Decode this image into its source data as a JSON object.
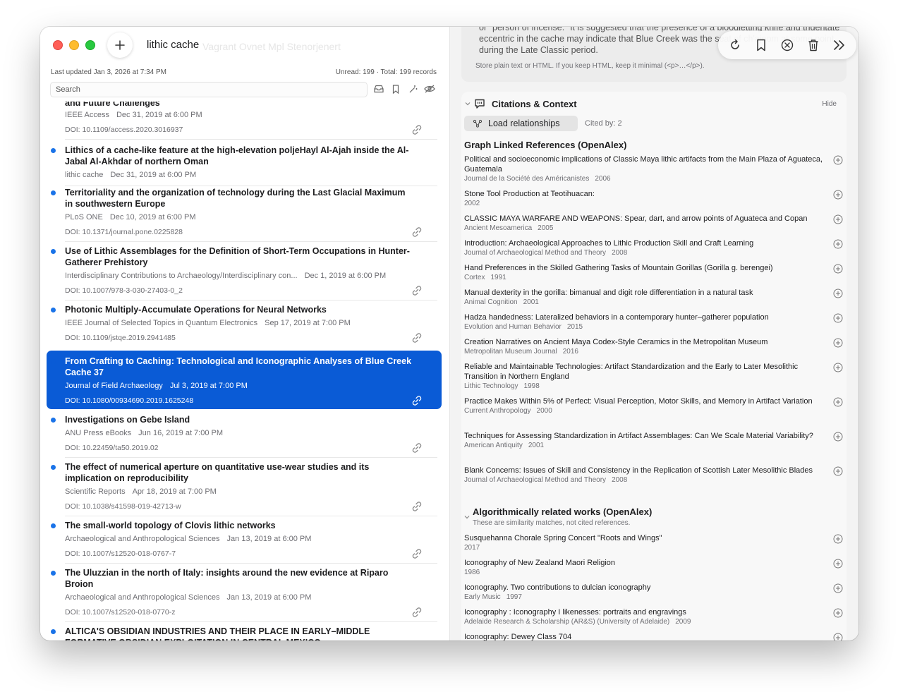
{
  "window": {
    "title": "lithic cache",
    "ghost_title": "Vagrant Ovnet Mpl Stenorjenert",
    "last_updated": "Last updated Jan 3, 2026 at 7:34 PM",
    "counts": "Unread: 199 · Total: 199 records",
    "search_placeholder": "Search"
  },
  "list": {
    "items": [
      {
        "title": "and Future Challenges",
        "source": "IEEE Access",
        "date": "Dec 31, 2019 at 6:00 PM",
        "doi": "DOI: 10.1109/access.2020.3016937",
        "unread": false
      },
      {
        "title": "Lithics of a cache-like feature at the high-elevation poljeHayl Al-Ajah inside the Al-Jabal Al-Akhdar of northern Oman",
        "source": "lithic cache",
        "date": "Dec 31, 2019 at 6:00 PM",
        "doi": "",
        "unread": true
      },
      {
        "title": "Territoriality and the organization of technology during the Last Glacial Maximum in southwestern Europe",
        "source": "PLoS ONE",
        "date": "Dec 10, 2019 at 6:00 PM",
        "doi": "DOI: 10.1371/journal.pone.0225828",
        "unread": true
      },
      {
        "title": "Use of Lithic Assemblages for the Definition of Short-Term Occupations in Hunter-Gatherer Prehistory",
        "source": "Interdisciplinary Contributions to Archaeology/Interdisciplinary con...",
        "date": "Dec 1, 2019 at 6:00 PM",
        "doi": "DOI: 10.1007/978-3-030-27403-0_2",
        "unread": true
      },
      {
        "title": "Photonic Multiply-Accumulate Operations for Neural Networks",
        "source": "IEEE Journal of Selected Topics in Quantum Electronics",
        "date": "Sep 17, 2019 at 7:00 PM",
        "doi": "DOI: 10.1109/jstqe.2019.2941485",
        "unread": true
      },
      {
        "title": "From Crafting to Caching: Technological and Iconographic Analyses of Blue Creek Cache 37",
        "source": "Journal of Field Archaeology",
        "date": "Jul 3, 2019 at 7:00 PM",
        "doi": "DOI: 10.1080/00934690.2019.1625248",
        "unread": true,
        "selected": true
      },
      {
        "title": "Investigations on Gebe Island",
        "source": "ANU Press eBooks",
        "date": "Jun 16, 2019 at 7:00 PM",
        "doi": "DOI: 10.22459/ta50.2019.02",
        "unread": true
      },
      {
        "title": "The effect of numerical aperture on quantitative use-wear studies and its implication on reproducibility",
        "source": "Scientific Reports",
        "date": "Apr 18, 2019 at 7:00 PM",
        "doi": "DOI: 10.1038/s41598-019-42713-w",
        "unread": true
      },
      {
        "title": "The small-world topology of Clovis lithic networks",
        "source": "Archaeological and Anthropological Sciences",
        "date": "Jan 13, 2019 at 6:00 PM",
        "doi": "DOI: 10.1007/s12520-018-0767-7",
        "unread": true
      },
      {
        "title": "The Uluzzian in the north of Italy: insights around the new evidence at Riparo Broion",
        "source": "Archaeological and Anthropological Sciences",
        "date": "Jan 13, 2019 at 6:00 PM",
        "doi": "DOI: 10.1007/s12520-018-0770-z",
        "unread": true
      },
      {
        "title": "ALTICA'S OBSIDIAN INDUSTRIES AND THEIR PLACE IN EARLY–MIDDLE FORMATIVE OBSIDIAN EXPLOITATION IN CENTRAL MEXICO",
        "source": "",
        "date": "",
        "doi": "",
        "unread": true
      }
    ]
  },
  "detail": {
    "note_text": "or \"person of incense.\" It is suggested that the presence of a bloodletting knife and tridentate eccentric in the cache may indicate that Blue Creek was the seat of ch'ajoom at some point during the Late Classic period.",
    "note_hint": "Store plain text or HTML. If you keep HTML, keep it minimal (<p>…</p>).",
    "citations": {
      "title": "Citations & Context",
      "hide_label": "Hide",
      "load_label": "Load relationships",
      "cited_by": "Cited by: 2",
      "linked_heading": "Graph Linked References (OpenAlex)",
      "linked": [
        {
          "title": "Political and socioeconomic implications of Classic Maya lithic artifacts from the Main Plaza of Aguateca, Guatemala",
          "journal": "Journal de la Société des Américanistes",
          "year": "2006"
        },
        {
          "title": "Stone Tool Production at Teotihuacan:",
          "journal": "",
          "year": "2002"
        },
        {
          "title": "CLASSIC MAYA WARFARE AND WEAPONS: Spear, dart, and arrow points of Aguateca and Copan",
          "journal": "Ancient Mesoamerica",
          "year": "2005"
        },
        {
          "title": "Introduction: Archaeological Approaches to Lithic Production Skill and Craft Learning",
          "journal": "Journal of Archaeological Method and Theory",
          "year": "2008"
        },
        {
          "title": "Hand Preferences in the Skilled Gathering Tasks of Mountain Gorillas (Gorilla g. berengei)",
          "journal": "Cortex",
          "year": "1991"
        },
        {
          "title": "Manual dexterity in the gorilla: bimanual and digit role differentiation in a natural task",
          "journal": "Animal Cognition",
          "year": "2001"
        },
        {
          "title": "Hadza handedness: Lateralized behaviors in a contemporary hunter–gatherer population",
          "journal": "Evolution and Human Behavior",
          "year": "2015"
        },
        {
          "title": "Creation Narratives on Ancient Maya Codex-Style Ceramics in the Metropolitan Museum",
          "journal": "Metropolitan Museum Journal",
          "year": "2016"
        },
        {
          "title": "Reliable and Maintainable Technologies: Artifact Standardization and the Early to Later Mesolithic Transition in Northern England",
          "journal": "Lithic Technology",
          "year": "1998"
        },
        {
          "title": "Practice Makes Within 5% of Perfect: Visual Perception, Motor Skills, and Memory in Artifact Variation",
          "journal": "Current Anthropology",
          "year": "2000"
        },
        {
          "title": "Techniques for Assessing Standardization in Artifact Assemblages: Can We Scale Material Variability?",
          "journal": "American Antiquity",
          "year": "2001"
        },
        {
          "title": "Blank Concerns: Issues of Skill and Consistency in the Replication of Scottish Later Mesolithic Blades",
          "journal": "Journal of Archaeological Method and Theory",
          "year": "2008"
        }
      ],
      "related_heading": "Algorithmically related works (OpenAlex)",
      "related_note": "These are similarity matches, not cited references.",
      "related": [
        {
          "title": "Susquehanna Chorale Spring Concert \"Roots and Wings\"",
          "journal": "",
          "year": "2017"
        },
        {
          "title": "Iconography of New Zealand Maori Religion",
          "journal": "",
          "year": "1986"
        },
        {
          "title": "Iconography. Two contributions to dulcian iconography",
          "journal": "Early Music",
          "year": "1997"
        },
        {
          "title": "Iconography : Iconography I likenesses: portraits and engravings",
          "journal": "Adelaide Research & Scholarship (AR&S) (University of Adelaide)",
          "year": "2009"
        },
        {
          "title": "Iconography: Dewey Class 704",
          "journal": "",
          "year": ""
        }
      ]
    }
  },
  "colors": {
    "accent": "#0a5bd6",
    "unread_dot": "#1a73e8"
  }
}
